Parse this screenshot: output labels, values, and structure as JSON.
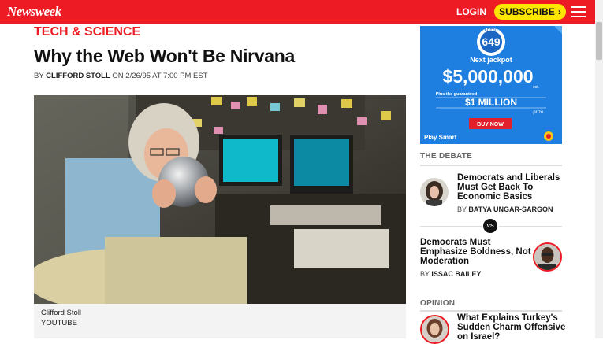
{
  "header": {
    "logo": "Newsweek",
    "login_label": "LOGIN",
    "subscribe_label": "SUBSCRIBE",
    "subscribe_arrow": "›"
  },
  "article": {
    "section": "TECH & SCIENCE",
    "title": "Why the Web Won't Be Nirvana",
    "byline_prefix": "BY",
    "author": "CLIFFORD STOLL",
    "byline_date": "ON 2/26/95 AT 7:00 PM EST",
    "caption": "Clifford Stoll",
    "credit": "YOUTUBE"
  },
  "ad": {
    "brand": "649",
    "brand_top": "LOTTO",
    "next_jackpot_label": "Next jackpot",
    "jackpot": "$5,000,000",
    "jackpot_suffix": "est.",
    "guaranteed_label": "Plus the guaranteed",
    "prize": "$1 MILLION",
    "prize_suffix": "prize.",
    "cta": "BUY NOW",
    "footer": "Play Smart"
  },
  "debate": {
    "heading": "THE DEBATE",
    "item1": {
      "title_line1": "Democrats and Liberals",
      "title_line2": "Must Get Back To",
      "title_line3": "Economic Basics",
      "by": "BY",
      "author": "BATYA UNGAR-SARGON"
    },
    "vs": "VS",
    "item2": {
      "title_line1": "Democrats Must",
      "title_line2": "Emphasize Boldness, Not",
      "title_line3": "Moderation",
      "by": "BY",
      "author": "ISSAC BAILEY"
    }
  },
  "opinion": {
    "heading": "OPINION",
    "item1": {
      "title_line1": "What Explains Turkey's",
      "title_line2": "Sudden Charm Offensive",
      "title_line3": "on Israel?"
    }
  },
  "colors": {
    "brand_red": "#ed1c24",
    "subscribe_yellow": "#ffe600",
    "ad_blue": "#1e7fe0"
  }
}
